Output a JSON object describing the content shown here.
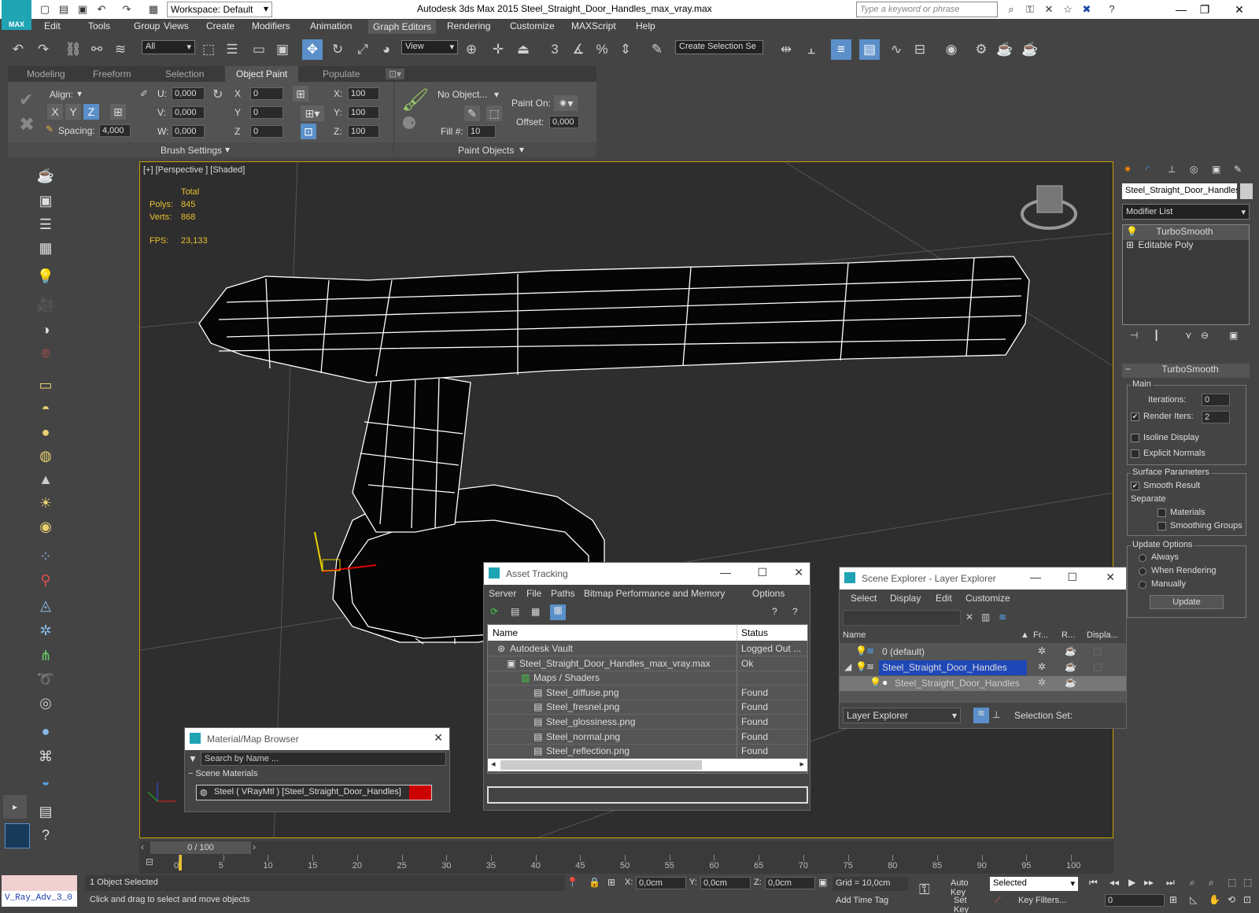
{
  "title_bar": {
    "app_title": "Autodesk 3ds Max  2015     Steel_Straight_Door_Handles_max_vray.max",
    "workspace": "Workspace: Default",
    "search_placeholder": "Type a keyword or phrase",
    "logo_text": "MAX"
  },
  "menu": [
    "Edit",
    "Tools",
    "Group",
    "Views",
    "Create",
    "Modifiers",
    "Animation",
    "Graph Editors",
    "Rendering",
    "Customize",
    "MAXScript",
    "Help"
  ],
  "toolbar": {
    "filter": "All",
    "ref_coord": "View",
    "selection_set": "Create Selection Se"
  },
  "ribbon_tabs": [
    "Modeling",
    "Freeform",
    "Selection",
    "Object Paint",
    "Populate"
  ],
  "ribbon": {
    "align_label": "Align:",
    "axes": [
      "X",
      "Y",
      "Z"
    ],
    "spacing_label": "Spacing:",
    "spacing_value": "4,000",
    "u_label": "U:",
    "u_value": "0,000",
    "v_label": "V:",
    "v_value": "0,000",
    "w_label": "W:",
    "w_value": "0,000",
    "x_label": "X",
    "x_value": "0",
    "y_label": "Y",
    "y_value": "0",
    "z_label": "Z",
    "z_value": "0",
    "sx_label": "X:",
    "sx_value": "100",
    "sy_label": "Y:",
    "sy_value": "100",
    "sz_label": "Z:",
    "sz_value": "100",
    "no_object": "No Object...",
    "fill_label": "Fill #:",
    "fill_value": "10",
    "paint_on_label": "Paint On:",
    "offset_label": "Offset:",
    "offset_value": "0,000",
    "brush_settings": "Brush Settings",
    "paint_objects": "Paint Objects"
  },
  "viewport": {
    "label": "[+] [Perspective ] [Shaded]",
    "stats_total": "Total",
    "polys_label": "Polys:",
    "polys_value": "845",
    "verts_label": "Verts:",
    "verts_value": "868",
    "fps_label": "FPS:",
    "fps_value": "23,133"
  },
  "command_panel": {
    "object_name": "Steel_Straight_Door_Handles",
    "modifier_list": "Modifier List",
    "stack": [
      "TurboSmooth",
      "Editable Poly"
    ],
    "rollout_title": "TurboSmooth",
    "main_group": "Main",
    "iterations_label": "Iterations:",
    "iterations_value": "0",
    "render_iters_label": "Render Iters:",
    "render_iters_value": "2",
    "isoline": "Isoline Display",
    "explicit_normals": "Explicit Normals",
    "surface_params": "Surface Parameters",
    "smooth_result": "Smooth Result",
    "separate": "Separate",
    "materials": "Materials",
    "smoothing_groups": "Smoothing Groups",
    "update_options": "Update Options",
    "always": "Always",
    "when_rendering": "When Rendering",
    "manually": "Manually",
    "update_button": "Update"
  },
  "asset_tracking": {
    "title": "Asset Tracking",
    "menus": [
      "Server",
      "File",
      "Paths",
      "Bitmap Performance and Memory",
      "Options"
    ],
    "col_name": "Name",
    "col_status": "Status",
    "rows": [
      {
        "name": "Autodesk Vault",
        "status": "Logged Out ..."
      },
      {
        "name": "Steel_Straight_Door_Handles_max_vray.max",
        "status": "Ok"
      },
      {
        "name": "Maps / Shaders",
        "status": ""
      },
      {
        "name": "Steel_diffuse.png",
        "status": "Found"
      },
      {
        "name": "Steel_fresnel.png",
        "status": "Found"
      },
      {
        "name": "Steel_glossiness.png",
        "status": "Found"
      },
      {
        "name": "Steel_normal.png",
        "status": "Found"
      },
      {
        "name": "Steel_reflection.png",
        "status": "Found"
      }
    ]
  },
  "scene_explorer": {
    "title": "Scene Explorer - Layer Explorer",
    "menus": [
      "Select",
      "Display",
      "Edit",
      "Customize"
    ],
    "col_name": "Name",
    "col_frozen": "Fr...",
    "col_render": "R...",
    "col_display": "Displa...",
    "rows": [
      "0 (default)",
      "Steel_Straight_Door_Handles",
      "Steel_Straight_Door_Handles"
    ],
    "footer_dropdown": "Layer Explorer",
    "selection_set_label": "Selection Set:"
  },
  "material_browser": {
    "title": "Material/Map Browser",
    "search_placeholder": "Search by Name ...",
    "group": "Scene Materials",
    "item": "Steel  ( VRayMtl ) [Steel_Straight_Door_Handles]"
  },
  "timeline": {
    "frame_display": "0 / 100",
    "ticks": [
      "0",
      "5",
      "10",
      "15",
      "20",
      "25",
      "30",
      "35",
      "40",
      "45",
      "50",
      "55",
      "60",
      "65",
      "70",
      "75",
      "80",
      "85",
      "90",
      "95",
      "100"
    ]
  },
  "status": {
    "script_listener": "V_Ray_Adv_3_0",
    "selected_count": "1 Object Selected",
    "prompt": "Click and drag to select and move objects",
    "x_label": "X:",
    "x_value": "0,0cm",
    "y_label": "Y:",
    "y_value": "0,0cm",
    "z_label": "Z:",
    "z_value": "0,0cm",
    "grid": "Grid = 10,0cm",
    "add_time_tag": "Add Time Tag",
    "auto_key": "Auto Key",
    "set_key": "Set Key",
    "key_mode": "Selected",
    "key_filters": "Key Filters...",
    "frame_value": "0"
  }
}
